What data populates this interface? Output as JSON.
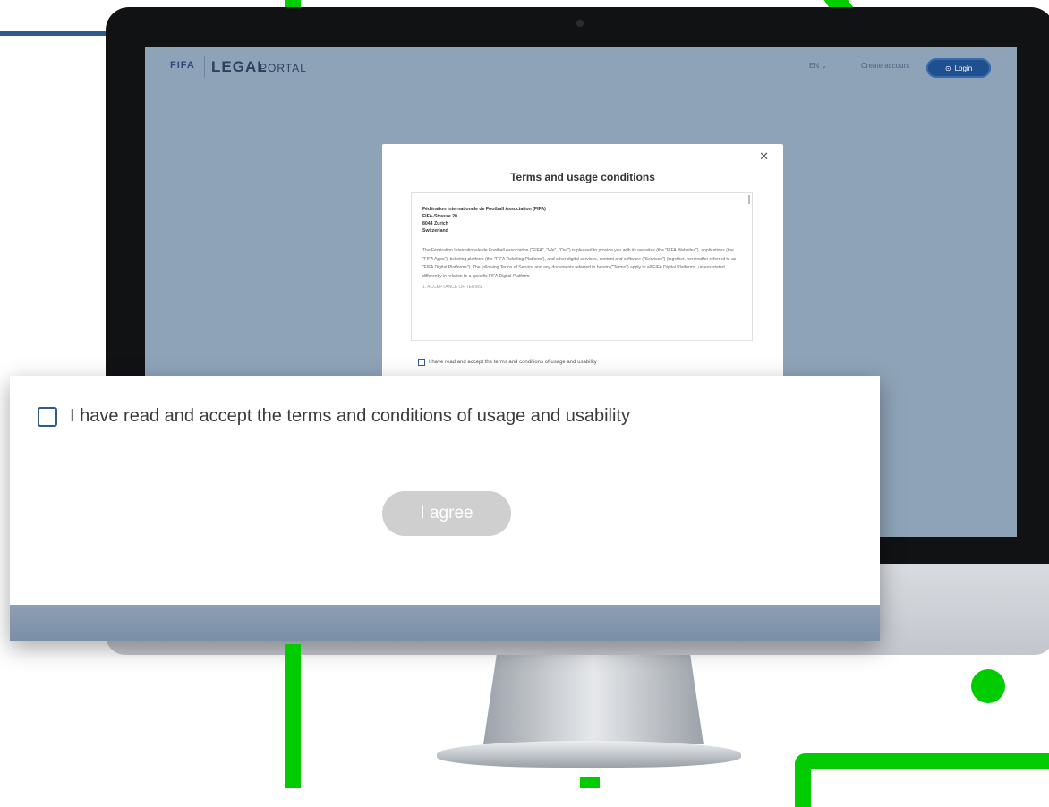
{
  "portal": {
    "logo_fifa": "FIFA",
    "logo_legal": "LEGAL",
    "logo_portal": "PORTAL",
    "language": "EN  ⌄",
    "create_account": "Create account",
    "login": "Login"
  },
  "modal": {
    "title": "Terms and usage conditions",
    "address": [
      "Fédération Internationale de Football Association (FIFA)",
      "FIFA-Strasse 20",
      "8044 Zurich",
      "Switzerland"
    ],
    "body": "The Fédération Internationale de Football Association (\"FIFA\", \"We\", \"Our\") is pleased to provide you with its websites (the \"FIFA Websites\"), applications (the \"FIFA Apps\"), ticketing platform (the \"FIFA Ticketing Platform\"), and other digital services, content and software (\"Services\") (together, hereinafter referred to as \"FIFA Digital Platforms\"). The following Terms of Service and any documents referred to herein (\"Terms\") apply to all FIFA Digital Platforms, unless stated differently in relation to a specific FIFA Digital Platform.",
    "more": "1. ACCEPTANCE OF TERMS",
    "checkbox_label": "I have read and accept the terms and conditions of usage and usability"
  },
  "zoom": {
    "checkbox_label": "I have read and accept the terms and conditions of usage and usability",
    "agree_button": "I agree"
  },
  "colors": {
    "accent_green": "#00cc00",
    "brand_blue": "#1e4f8f",
    "disabled_button": "#cfcfcf"
  }
}
